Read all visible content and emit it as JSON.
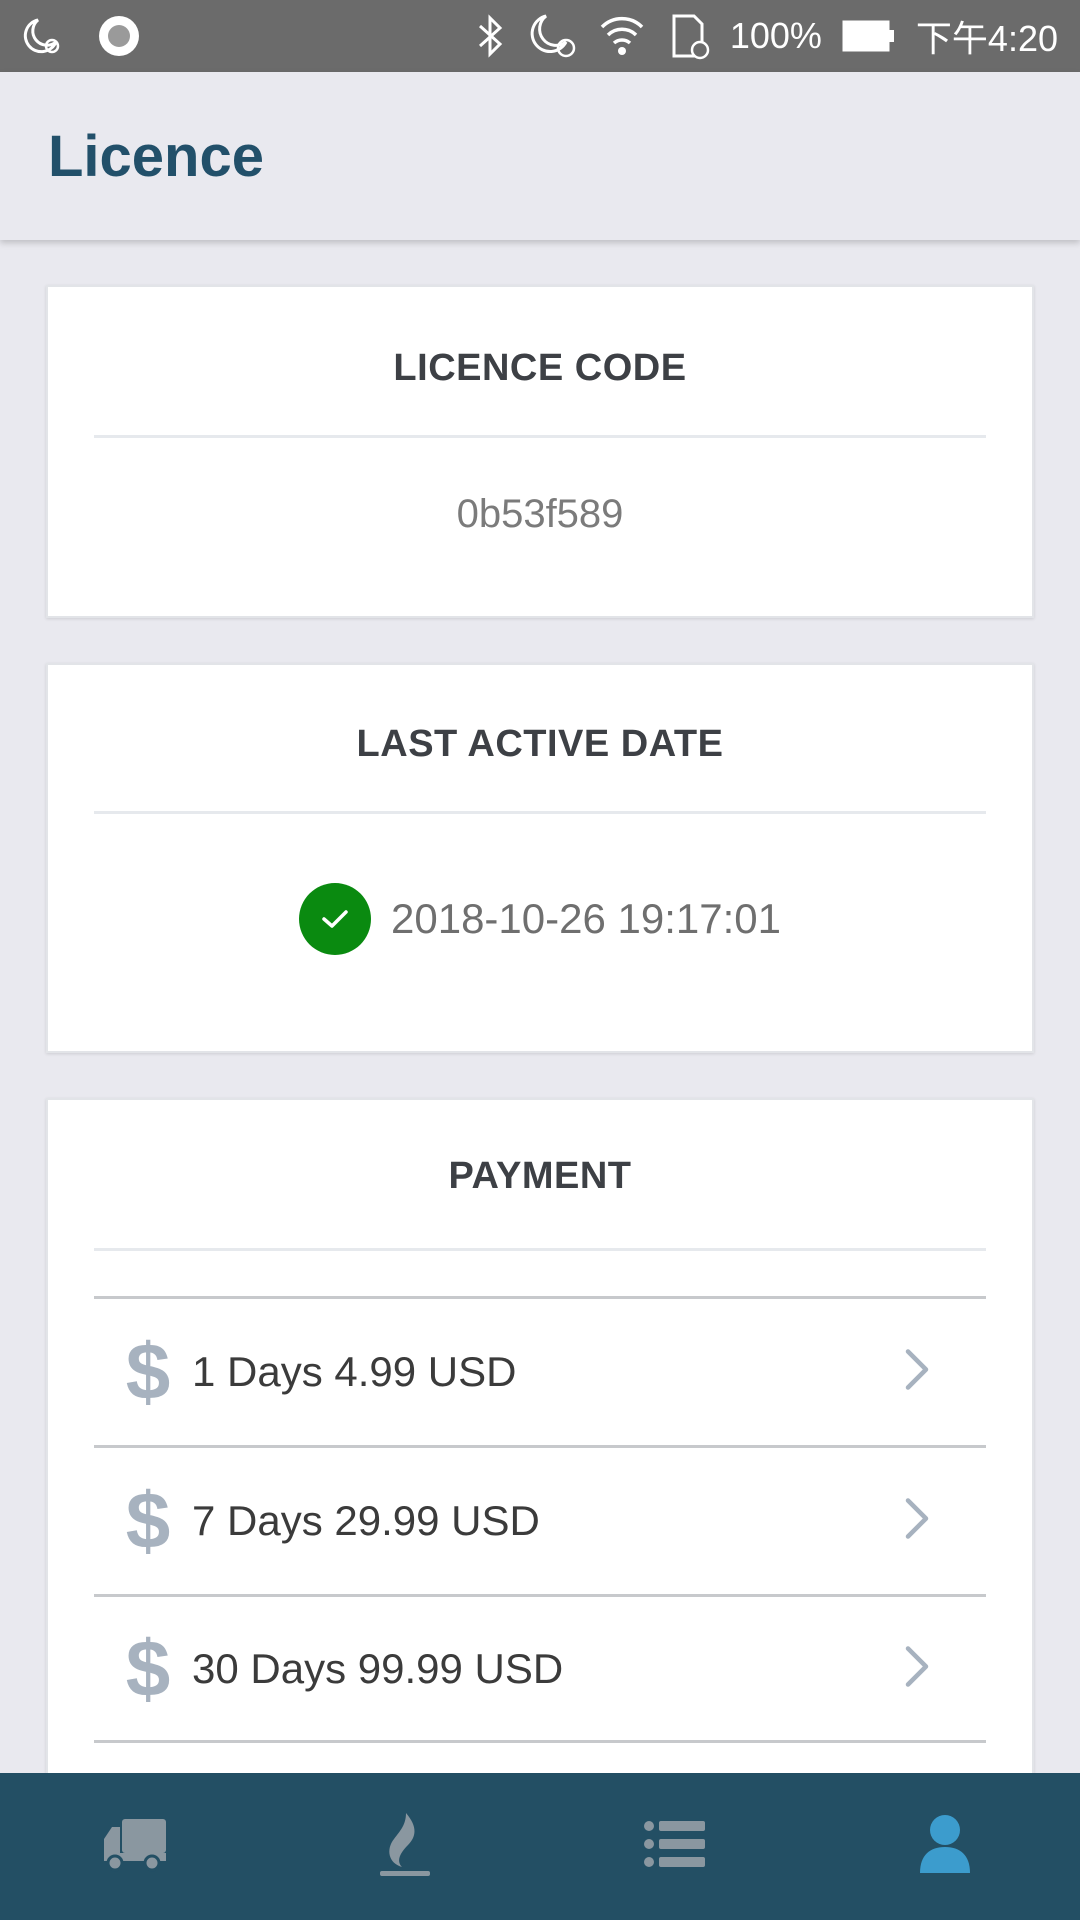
{
  "status_bar": {
    "battery": "100%",
    "time": "下午4:20",
    "icons": [
      "moon-alarm-icon",
      "record-icon",
      "bluetooth-icon",
      "moon-alarm-icon",
      "wifi-icon",
      "sd-card-icon",
      "battery-icon"
    ]
  },
  "header": {
    "title": "Licence"
  },
  "licence_card": {
    "heading": "LICENCE CODE",
    "code": "0b53f589"
  },
  "active_card": {
    "heading": "LAST ACTIVE DATE",
    "date": "2018-10-26 19:17:01",
    "status_color": "#0a8a10"
  },
  "payment_card": {
    "heading": "PAYMENT",
    "items": [
      {
        "icon": "dollar-icon",
        "label": "1 Days 4.99 USD"
      },
      {
        "icon": "dollar-icon",
        "label": "7 Days 29.99 USD"
      },
      {
        "icon": "dollar-icon",
        "label": "30 Days 99.99 USD"
      }
    ]
  },
  "bottom_nav": {
    "items": [
      {
        "icon": "truck-icon"
      },
      {
        "icon": "flame-icon"
      },
      {
        "icon": "list-icon"
      },
      {
        "icon": "user-icon",
        "active": true
      }
    ],
    "active_color": "#3c9ccd",
    "inactive_color": "#8a97a0"
  },
  "colors": {
    "title": "#22506a",
    "nav_bg": "#234f64"
  }
}
